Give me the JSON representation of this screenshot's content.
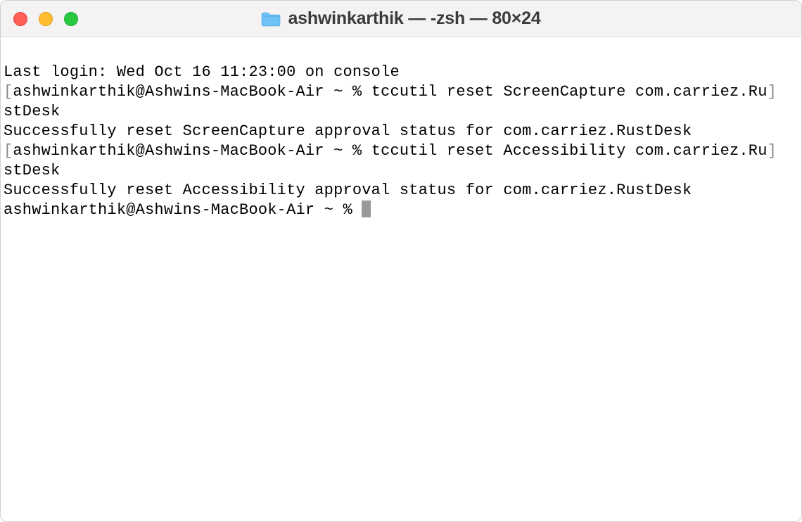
{
  "window": {
    "title": "ashwinkarthik — -zsh — 80×24"
  },
  "terminal": {
    "last_login": "Last login: Wed Oct 16 11:23:00 on console",
    "bracket_open": "[",
    "bracket_close": "]",
    "prompt_user_host": "ashwinkarthik@Ashwins-MacBook-Air ~ % ",
    "cmd1_part1": "tccutil reset ScreenCapture com.carriez.Ru",
    "cmd1_wrap": "stDesk",
    "result1": "Successfully reset ScreenCapture approval status for com.carriez.RustDesk",
    "cmd2_part1": "tccutil reset Accessibility com.carriez.Ru",
    "cmd2_wrap": "stDesk",
    "result2": "Successfully reset Accessibility approval status for com.carriez.RustDesk",
    "prompt_final": "ashwinkarthik@Ashwins-MacBook-Air ~ % "
  }
}
